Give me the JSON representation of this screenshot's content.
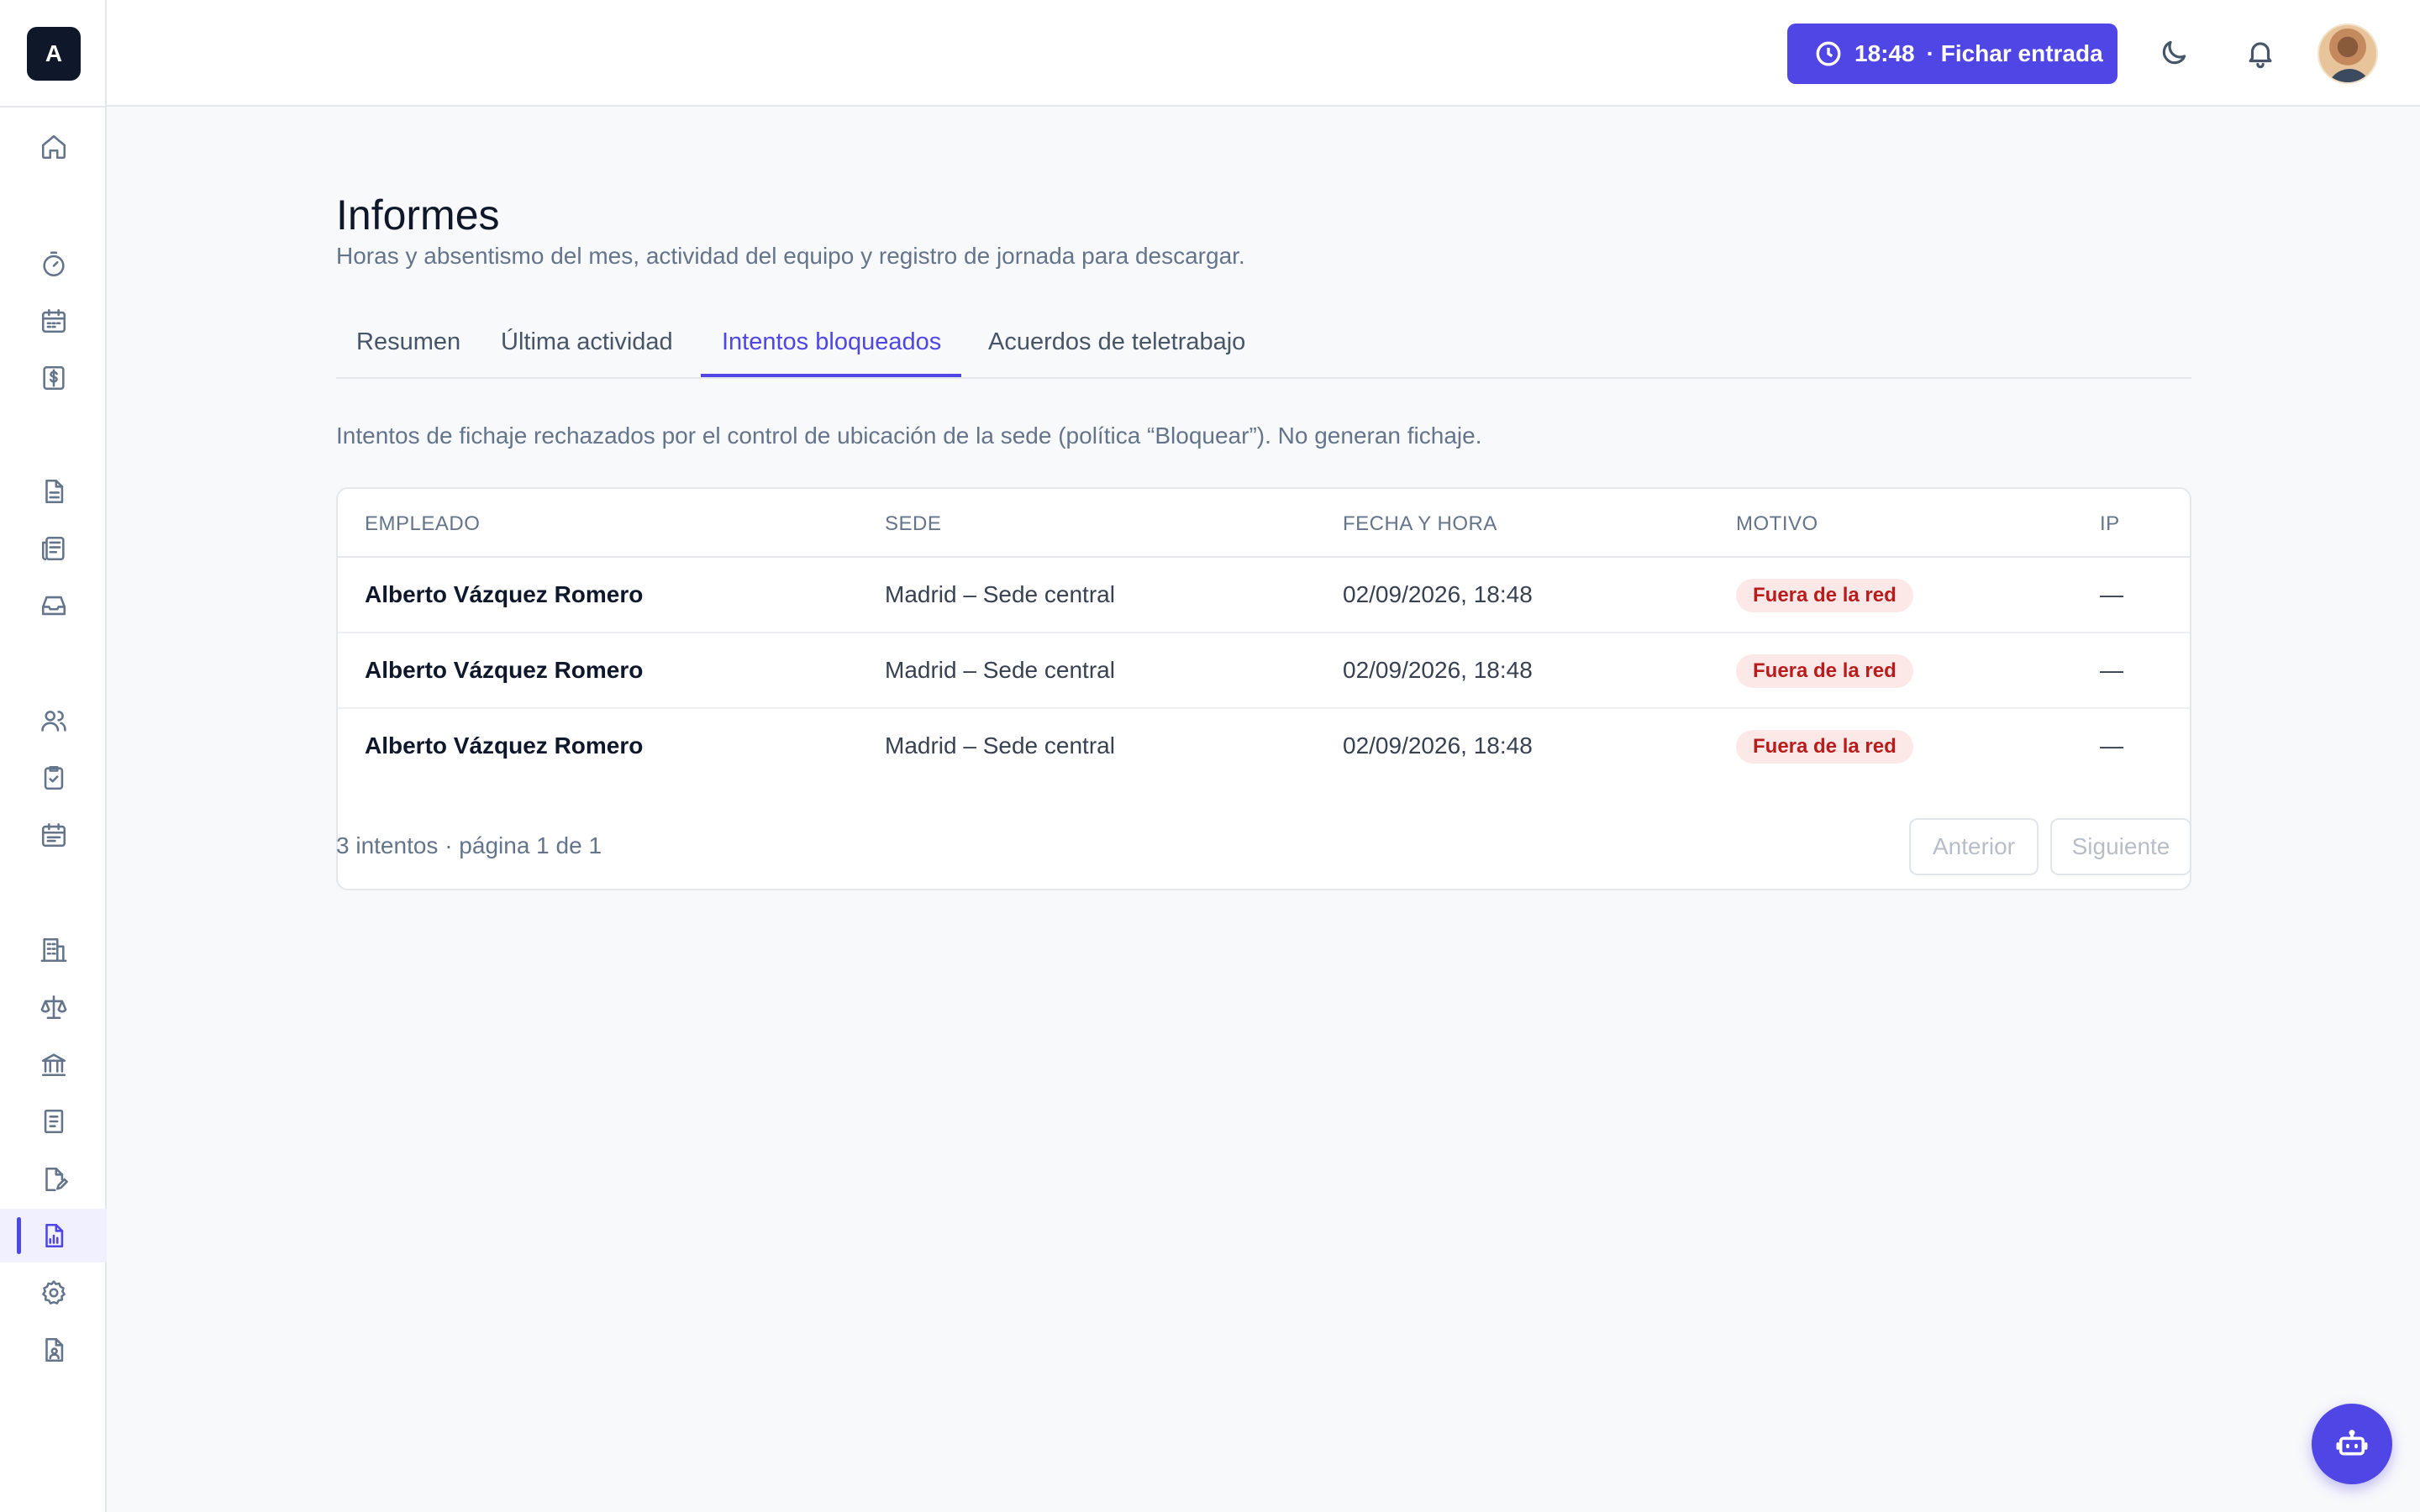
{
  "app": {
    "logo_letter": "A"
  },
  "topbar": {
    "clock_time": "18:48",
    "clock_action": "· Fichar entrada",
    "theme_icon": "moon-icon",
    "notifications_icon": "bell-icon"
  },
  "sidebar": {
    "items": [
      {
        "icon": "home-icon",
        "active": false
      },
      {
        "icon": "timer-icon",
        "active": false
      },
      {
        "icon": "calendar-icon",
        "active": false
      },
      {
        "icon": "dollar-document-icon",
        "active": false
      },
      {
        "icon": "document-icon",
        "active": false
      },
      {
        "icon": "newspaper-icon",
        "active": false
      },
      {
        "icon": "inbox-icon",
        "active": false
      },
      {
        "icon": "users-icon",
        "active": false
      },
      {
        "icon": "clipboard-check-icon",
        "active": false
      },
      {
        "icon": "calendar-list-icon",
        "active": false
      },
      {
        "icon": "building-icon",
        "active": false
      },
      {
        "icon": "scale-icon",
        "active": false
      },
      {
        "icon": "bank-icon",
        "active": false
      },
      {
        "icon": "receipt-icon",
        "active": false
      },
      {
        "icon": "document-edit-icon",
        "active": false
      },
      {
        "icon": "report-chart-icon",
        "active": true
      },
      {
        "icon": "settings-icon",
        "active": false
      },
      {
        "icon": "user-document-icon",
        "active": false
      }
    ]
  },
  "page": {
    "title": "Informes",
    "subtitle": "Horas y absentismo del mes, actividad del equipo y registro de jornada para descargar.",
    "tabs": [
      {
        "label": "Resumen",
        "active": false
      },
      {
        "label": "Última actividad",
        "active": false
      },
      {
        "label": "Intentos bloqueados",
        "active": true
      },
      {
        "label": "Acuerdos de teletrabajo",
        "active": false
      }
    ],
    "description": "Intentos de fichaje rechazados por el control de ubicación de la sede (política “Bloquear”). No generan fichaje."
  },
  "table": {
    "columns": [
      "EMPLEADO",
      "SEDE",
      "FECHA Y HORA",
      "MOTIVO",
      "IP"
    ],
    "rows": [
      {
        "employee": "Alberto Vázquez Romero",
        "site": "Madrid – Sede central",
        "datetime": "02/09/2026, 18:48",
        "reason": "Fuera de la red",
        "ip": "—"
      },
      {
        "employee": "Alberto Vázquez Romero",
        "site": "Madrid – Sede central",
        "datetime": "02/09/2026, 18:48",
        "reason": "Fuera de la red",
        "ip": "—"
      },
      {
        "employee": "Alberto Vázquez Romero",
        "site": "Madrid – Sede central",
        "datetime": "02/09/2026, 18:48",
        "reason": "Fuera de la red",
        "ip": "—"
      }
    ]
  },
  "pagination": {
    "info": "3 intentos · página 1 de 1",
    "prev_label": "Anterior",
    "next_label": "Siguiente"
  },
  "colors": {
    "accent": "#4f46e5",
    "badge_bg": "#fde8e8",
    "badge_text": "#b91c1c"
  },
  "fab": {
    "icon": "robot-icon"
  }
}
